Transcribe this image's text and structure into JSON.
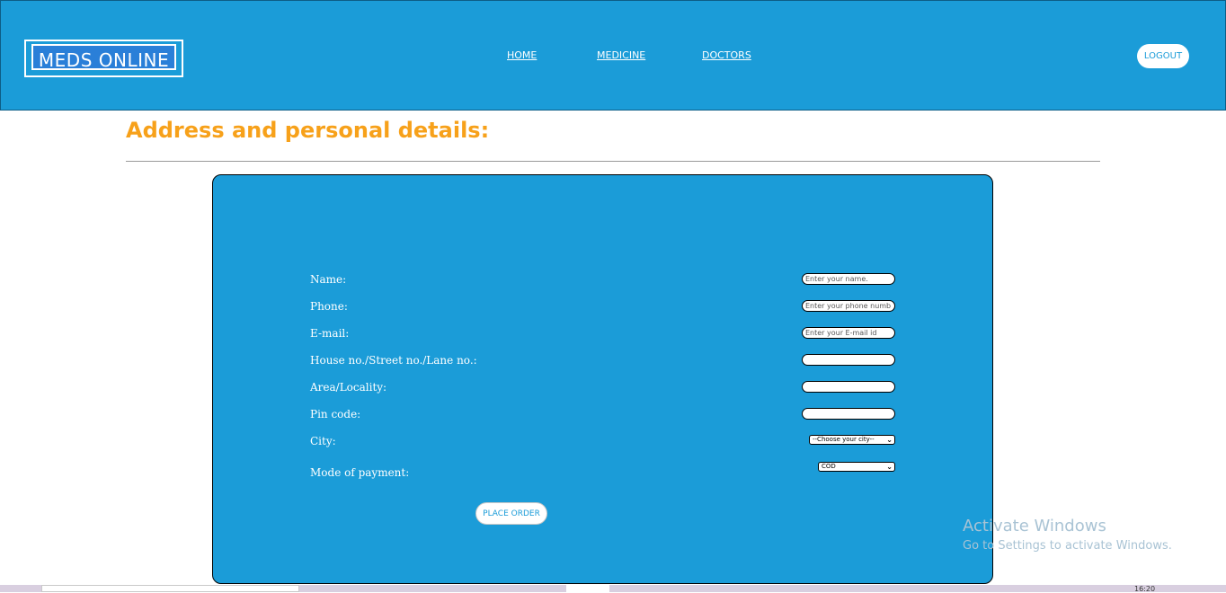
{
  "header": {
    "logo": "MEDS ONLINE",
    "nav": [
      "HOME",
      "MEDICINE",
      "DOCTORS"
    ],
    "logout": "LOGOUT"
  },
  "page_title": "Address and personal details:",
  "form": {
    "fields": [
      {
        "label": "Name:",
        "placeholder": "Enter your name."
      },
      {
        "label": "Phone:",
        "placeholder": "Enter your phone numb"
      },
      {
        "label": "E-mail:",
        "placeholder": "Enter your E-mail id"
      },
      {
        "label": "House no./Street no./Lane no.:",
        "placeholder": ""
      },
      {
        "label": "Area/Locality:",
        "placeholder": ""
      },
      {
        "label": "Pin code:",
        "placeholder": ""
      }
    ],
    "city": {
      "label": "City:",
      "selected": "--Choose your city--"
    },
    "payment": {
      "label": "Mode of payment:",
      "selected": "COD"
    },
    "submit": "PLACE ORDER"
  },
  "watermark": {
    "title": "Activate Windows",
    "subtitle": "Go to Settings to activate Windows."
  },
  "taskbar": {
    "clock": "16:20"
  },
  "colors": {
    "header_bg": "#1b9cd8",
    "title": "#f7a11a",
    "panel_bg": "#1b9cd8"
  }
}
